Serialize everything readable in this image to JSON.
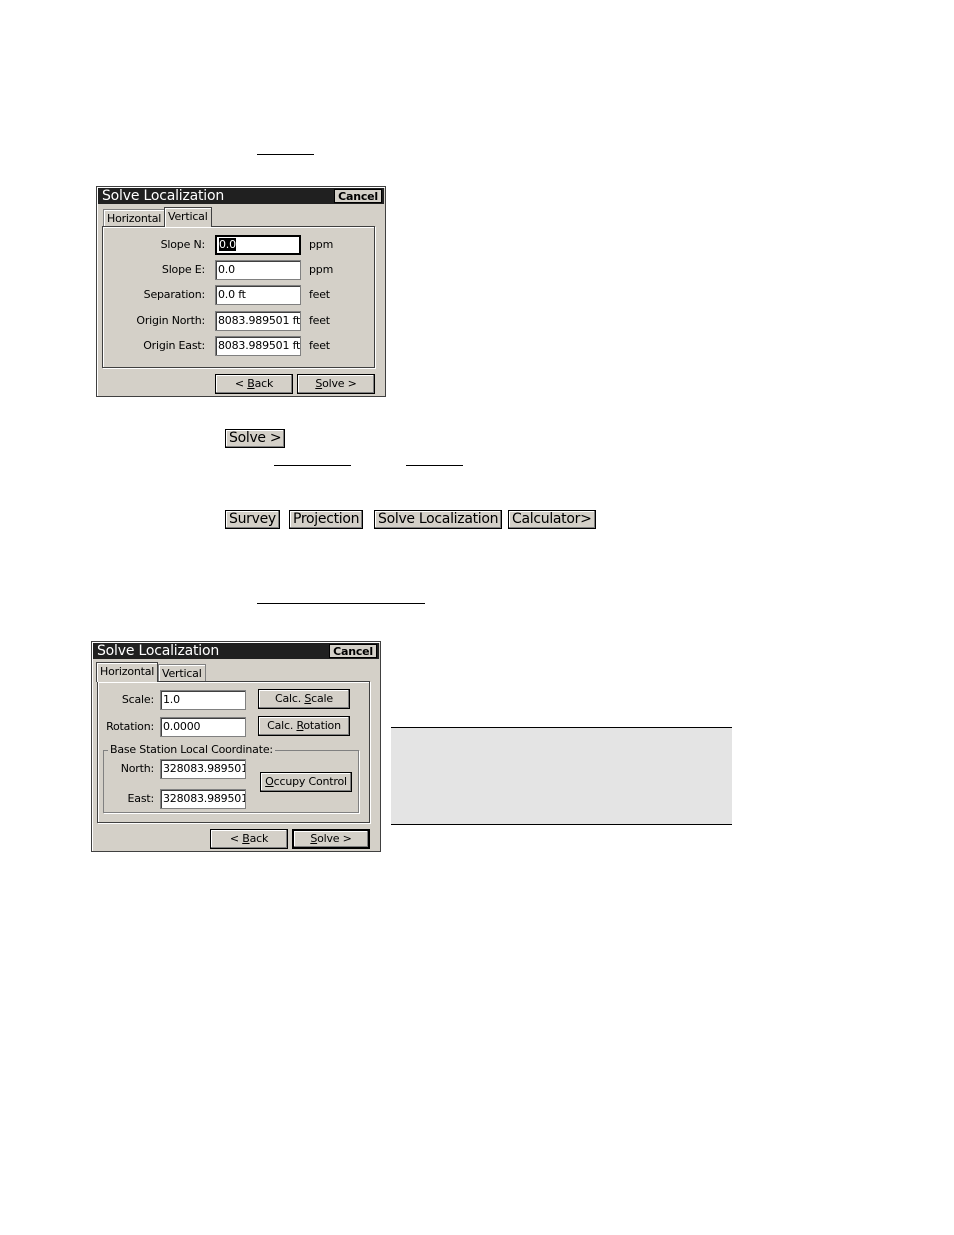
{
  "dialog_vertical": {
    "title": "Solve Localization",
    "cancel_label": "Cancel",
    "tabs": [
      {
        "label": "Horizontal",
        "active": false
      },
      {
        "label": "Vertical",
        "active": true
      }
    ],
    "fields": [
      {
        "label": "Slope N:",
        "value": "0.0",
        "unit": "ppm"
      },
      {
        "label": "Slope E:",
        "value": "0.0",
        "unit": "ppm"
      },
      {
        "label": "Separation:",
        "value": "0.0 ft",
        "unit": "feet"
      },
      {
        "label": "Origin North:",
        "value": "8083.989501 ft",
        "unit": "feet"
      },
      {
        "label": "Origin East:",
        "value": "8083.989501 ft",
        "unit": "feet"
      }
    ],
    "back": {
      "prefix": "< ",
      "key": "B",
      "rest": "ack"
    },
    "solve": {
      "key": "S",
      "rest": "olve >"
    }
  },
  "inline_solve_button": "Solve >",
  "menu_path": [
    "Survey",
    "Projection",
    "Solve Localization",
    "Calculator>"
  ],
  "dialog_horizontal": {
    "title": "Solve Localization",
    "cancel_label": "Cancel",
    "tabs": [
      {
        "label": "Horizontal",
        "active": true
      },
      {
        "label": "Vertical",
        "active": false
      }
    ],
    "scale": {
      "label": "Scale:",
      "value": "1.0",
      "button": {
        "prefix": "Calc. ",
        "key": "S",
        "rest": "cale"
      }
    },
    "rotation": {
      "label": "Rotation:",
      "value": "0.0000",
      "button": {
        "prefix": "Calc. ",
        "key": "R",
        "rest": "otation"
      }
    },
    "group_label": "Base Station Local Coordinate:",
    "north": {
      "label": "North:",
      "value": "328083.989501"
    },
    "east": {
      "label": "East:",
      "value": "328083.989501"
    },
    "occupy": {
      "key": "O",
      "rest": "ccupy Control"
    },
    "back": {
      "prefix": "< ",
      "key": "B",
      "rest": "ack"
    },
    "solve": {
      "key": "S",
      "rest": "olve >"
    }
  }
}
